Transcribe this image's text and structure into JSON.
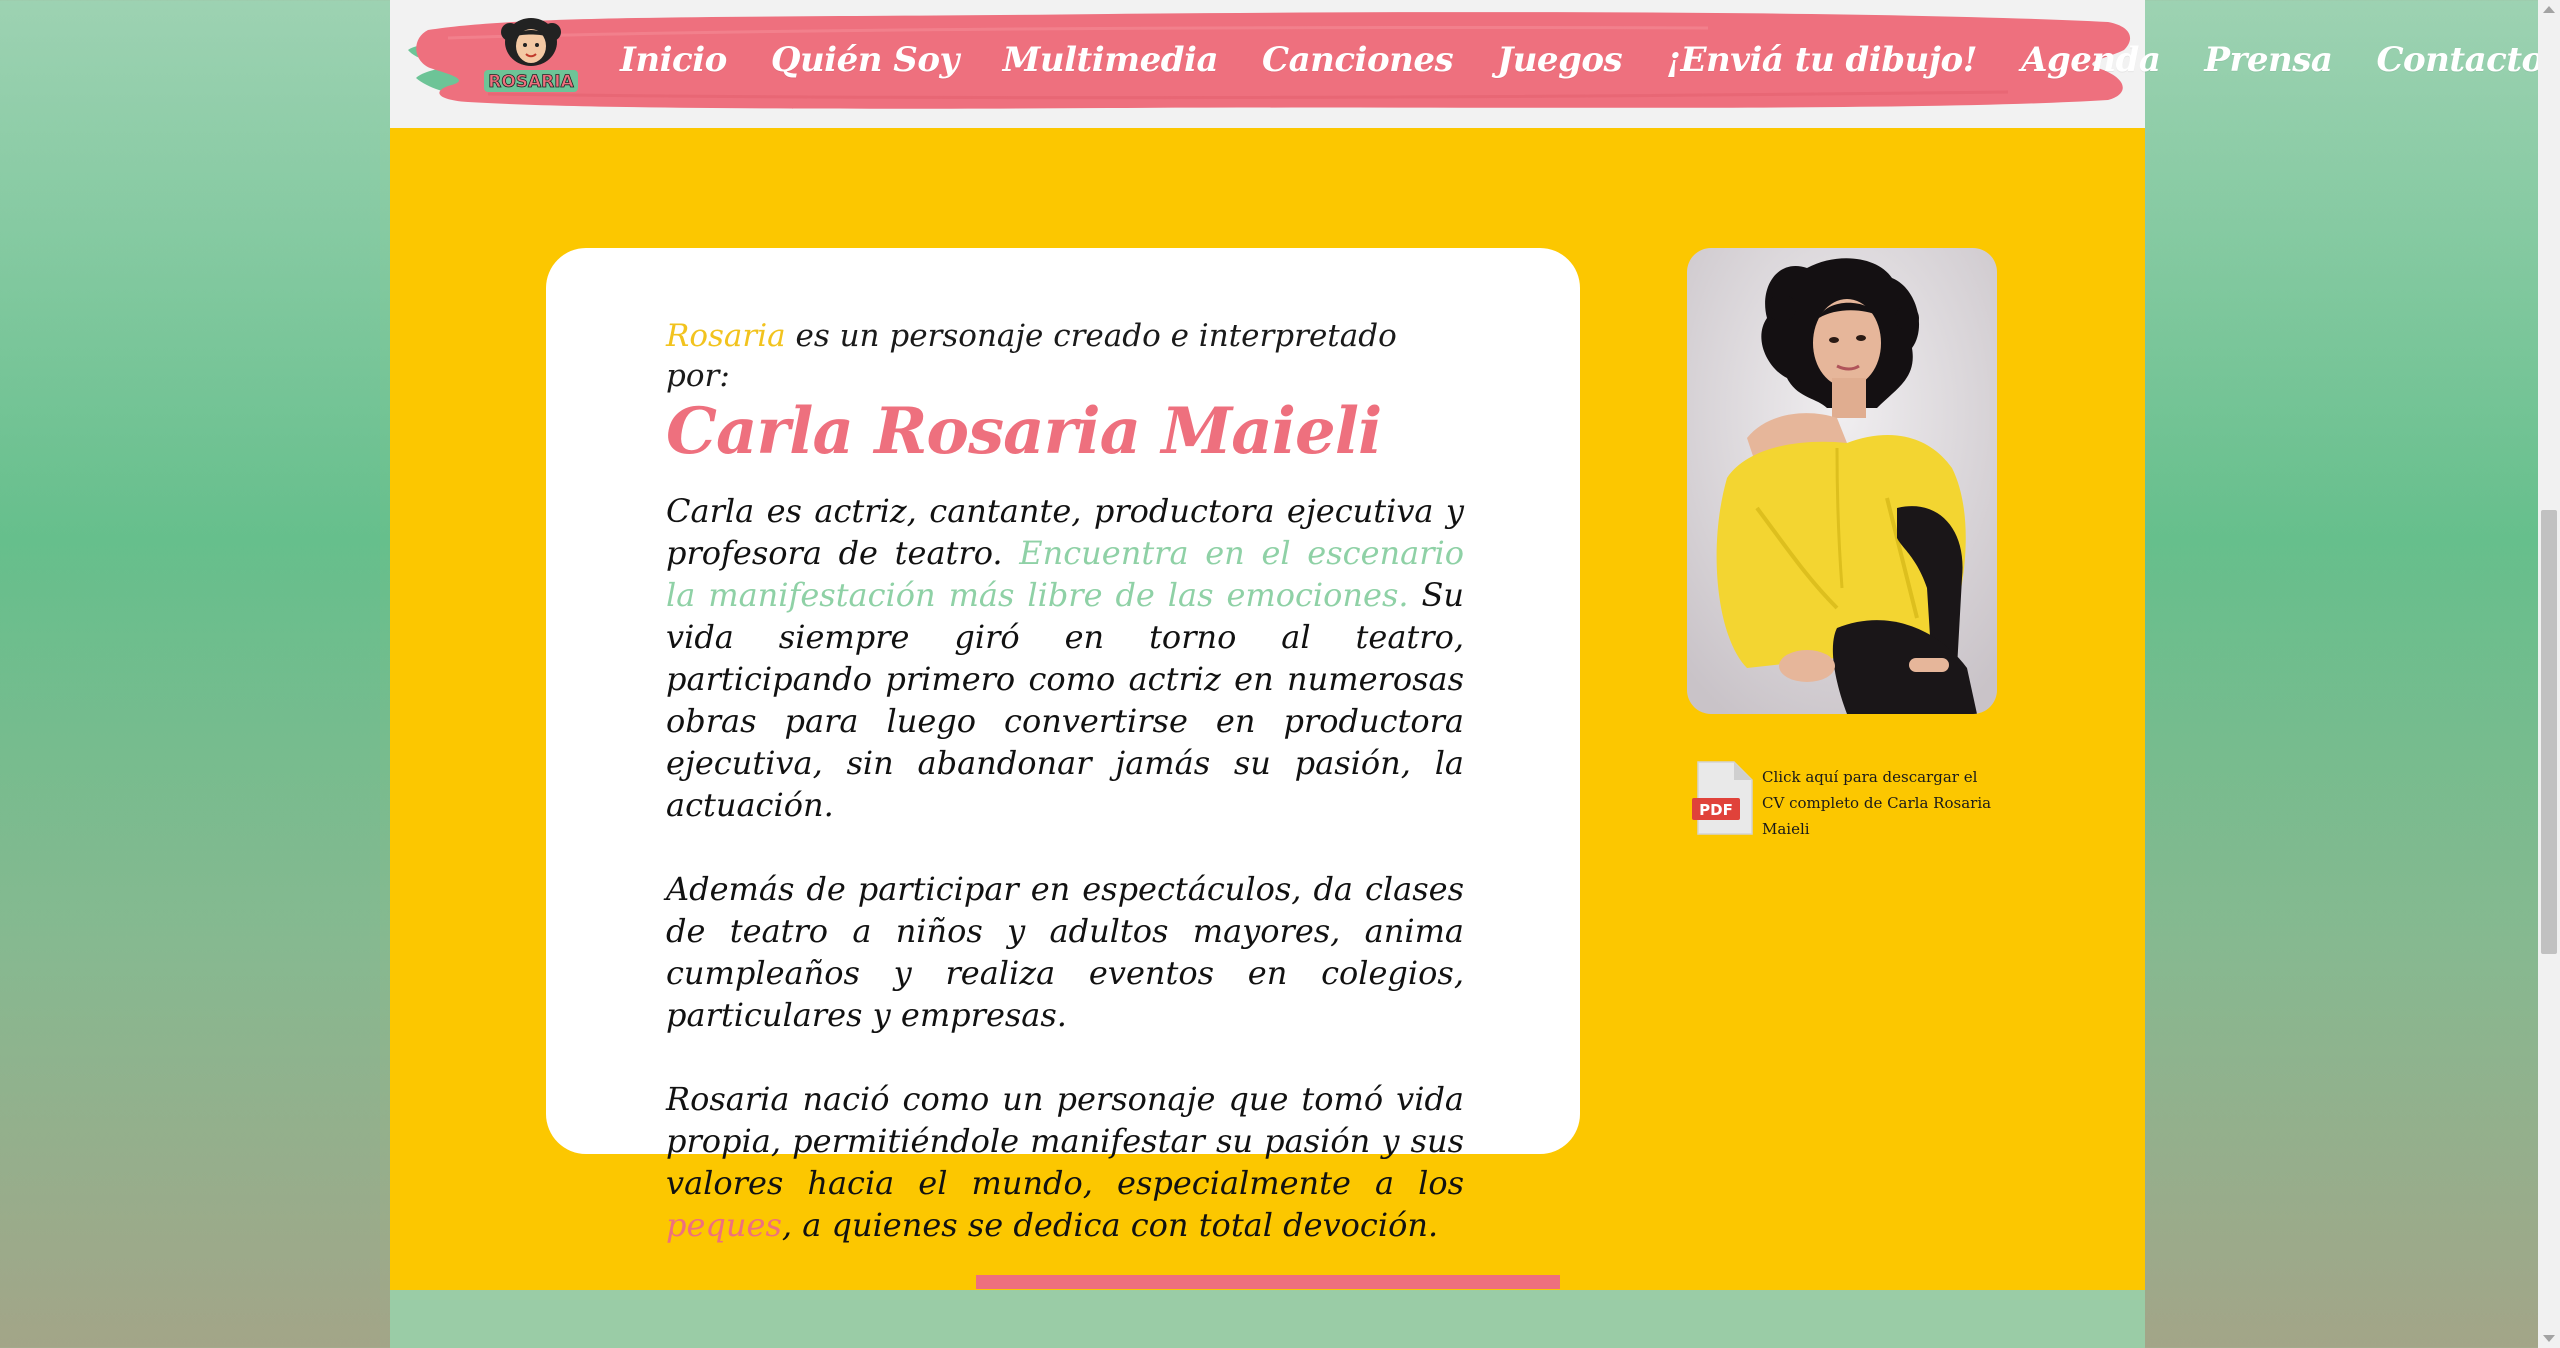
{
  "nav": {
    "logo_text": "ROSARIA",
    "items": [
      {
        "label": "Inicio"
      },
      {
        "label": "Quién Soy"
      },
      {
        "label": "Multimedia"
      },
      {
        "label": "Canciones"
      },
      {
        "label": "Juegos"
      },
      {
        "label": "¡Enviá tu dibujo!"
      },
      {
        "label": "Agenda"
      },
      {
        "label": "Prensa"
      },
      {
        "label": "Contacto"
      }
    ]
  },
  "about": {
    "intro_brand": "Rosaria",
    "intro_rest": " es un personaje creado e interpretado por:",
    "name": "Carla Rosaria Maieli",
    "p1_a": "Carla es actriz, cantante, productora ejecutiva y profesora de teatro. ",
    "p1_highlight": "Encuentra en el escenario la manifestación más libre de las emociones.",
    "p1_b": " Su vida siempre giró en torno al teatro, participando primero como actriz en numerosas obras para luego convertirse en productora ejecutiva, sin abandonar jamás su pasión, la actuación.",
    "p2": "Además de participar en espectáculos, da clases de teatro a niños y adultos mayores, anima cumpleaños y realiza eventos en colegios, particulares y empresas.",
    "p3_a": "Rosaria nació como un personaje que tomó vida propia, permitiéndole manifestar su pasión y sus valores hacia el mundo, especialmente a los ",
    "p3_highlight": "peques",
    "p3_b": ", a quienes se dedica con total devoción."
  },
  "cv": {
    "icon_label": "PDF",
    "link_text": "Click aquí para descargar el CV completo de Carla Rosaria Maieli"
  },
  "colors": {
    "page_bg": "#fcc700",
    "nav_brush": "#ee707e",
    "name_pink": "#ee707e",
    "highlight_green": "#8fd1a6",
    "brand_yellow": "#f2c31e",
    "accent_green": "#6dc497"
  }
}
